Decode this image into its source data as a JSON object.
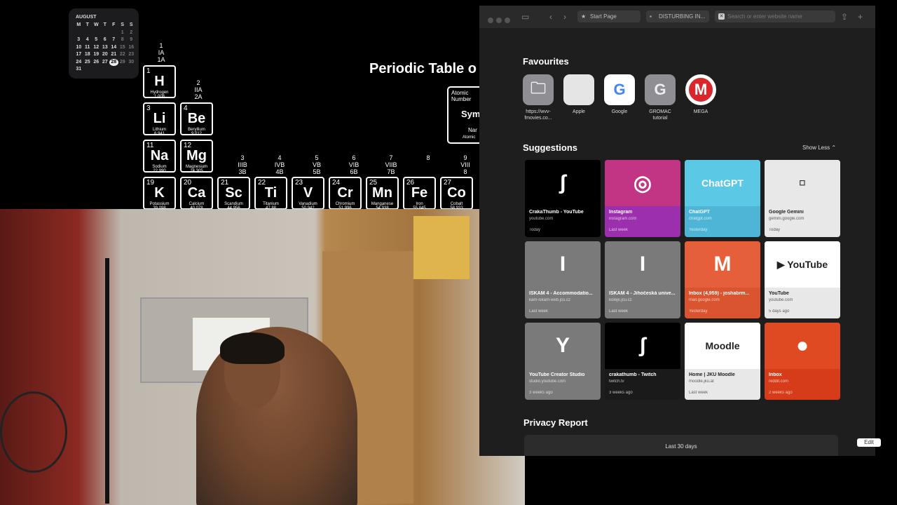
{
  "calendar": {
    "month": "AUGUST",
    "weekdays": [
      "M",
      "T",
      "W",
      "T",
      "F",
      "S",
      "S"
    ],
    "rows": [
      [
        "",
        "",
        "",
        "",
        "",
        "1",
        "2"
      ],
      [
        "3",
        "4",
        "5",
        "6",
        "7",
        "8",
        "9"
      ],
      [
        "10",
        "11",
        "12",
        "13",
        "14",
        "15",
        "16"
      ],
      [
        "17",
        "18",
        "19",
        "20",
        "21",
        "22",
        "23"
      ],
      [
        "24",
        "25",
        "26",
        "27",
        "28",
        "29",
        "30"
      ],
      [
        "31",
        "",
        "",
        "",
        "",
        "",
        ""
      ]
    ],
    "today": "28"
  },
  "periodic": {
    "title": "Periodic Table o",
    "group1": [
      "1",
      "IA",
      "1A"
    ],
    "group2": [
      "2",
      "IIA",
      "2A"
    ],
    "groups": [
      [
        "3",
        "IIIB",
        "3B"
      ],
      [
        "4",
        "IVB",
        "4B"
      ],
      [
        "5",
        "VB",
        "5B"
      ],
      [
        "6",
        "VIB",
        "6B"
      ],
      [
        "7",
        "VIIB",
        "7B"
      ],
      [
        "8",
        ""
      ],
      [
        "9",
        "VIII",
        "8"
      ]
    ],
    "legend": {
      "top": "Atomic Number",
      "mid": "Sym",
      "low": "Nar",
      "bottom": "Atomic"
    },
    "elements": [
      {
        "n": "1",
        "s": "H",
        "name": "Hydrogen",
        "m": "1.008"
      },
      {
        "n": "3",
        "s": "Li",
        "name": "Lithium",
        "m": "6.941"
      },
      {
        "n": "4",
        "s": "Be",
        "name": "Beryllium",
        "m": "9.012"
      },
      {
        "n": "11",
        "s": "Na",
        "name": "Sodium",
        "m": "22.990"
      },
      {
        "n": "12",
        "s": "Mg",
        "name": "Magnesium",
        "m": "24.305"
      },
      {
        "n": "19",
        "s": "K",
        "name": "Potassium",
        "m": "39.098"
      },
      {
        "n": "20",
        "s": "Ca",
        "name": "Calcium",
        "m": "40.078"
      },
      {
        "n": "21",
        "s": "Sc",
        "name": "Scandium",
        "m": "44.956"
      },
      {
        "n": "22",
        "s": "Ti",
        "name": "Titanium",
        "m": "47.88"
      },
      {
        "n": "23",
        "s": "V",
        "name": "Vanadium",
        "m": "50.942"
      },
      {
        "n": "24",
        "s": "Cr",
        "name": "Chromium",
        "m": "51.996"
      },
      {
        "n": "25",
        "s": "Mn",
        "name": "Manganese",
        "m": "54.938"
      },
      {
        "n": "26",
        "s": "Fe",
        "name": "Iron",
        "m": "55.845"
      },
      {
        "n": "27",
        "s": "Co",
        "name": "Cobalt",
        "m": "58.933"
      }
    ]
  },
  "safari": {
    "tabs": {
      "start": "Start Page",
      "second": "DISTURBING IN..."
    },
    "address_placeholder": "Search or enter website name",
    "favourites_title": "Favourites",
    "favourites": [
      {
        "label": "https://wvv-fmovies.co...",
        "icon": "folder-icon",
        "glyph": "🗀",
        "bg": "#8e8e93"
      },
      {
        "label": "Apple",
        "icon": "apple-icon",
        "glyph": "",
        "bg": "#e5e5e5"
      },
      {
        "label": "Google",
        "icon": "google-icon",
        "glyph": "G",
        "bg": "#ffffff"
      },
      {
        "label": "GROMAC tutorial",
        "icon": "letter-g-icon",
        "glyph": "G",
        "bg": "#8e8e93"
      },
      {
        "label": "MEGA",
        "icon": "mega-icon",
        "glyph": "M",
        "bg": "#ffffff"
      }
    ],
    "suggestions_title": "Suggestions",
    "show_less": "Show Less ⌃",
    "suggestions": [
      {
        "title": "CrakaThumb - YouTube",
        "url": "youtube.com",
        "when": "Today",
        "bg": "#000000",
        "thumb": "#000",
        "glyph": "ʃ",
        "fg": "#fff"
      },
      {
        "title": "Instagram",
        "url": "instagram.com",
        "when": "Last week",
        "bg": "#9b2fae",
        "thumb": "#c13584",
        "glyph": "◎",
        "fg": "#fff"
      },
      {
        "title": "ChatGPT",
        "url": "chatgpt.com",
        "when": "Yesterday",
        "bg": "#4fb5d6",
        "thumb": "#5bc8e6",
        "glyph": "ChatGPT",
        "fg": "#fff"
      },
      {
        "title": "Google Gemini",
        "url": "gemini.google.com",
        "when": "Today",
        "bg": "#e8e8e8",
        "thumb": "#e8e8e8",
        "glyph": "▫",
        "fg": "#333"
      },
      {
        "title": "ISKAM 4 - Accommodatio...",
        "url": "kam-iskam-web.jcu.cz",
        "when": "Last week",
        "bg": "#7a7a7a",
        "thumb": "#7a7a7a",
        "glyph": "I",
        "fg": "#fff"
      },
      {
        "title": "ISKAM 4 - Jihočeská unive...",
        "url": "koleje.jcu.cz",
        "when": "Last week",
        "bg": "#7a7a7a",
        "thumb": "#7a7a7a",
        "glyph": "I",
        "fg": "#fff"
      },
      {
        "title": "Inbox (4,959) - joshabrm...",
        "url": "mail.google.com",
        "when": "Yesterday",
        "bg": "#d9542f",
        "thumb": "#e5603a",
        "glyph": "M",
        "fg": "#fff"
      },
      {
        "title": "YouTube",
        "url": "youtube.com",
        "when": "5 days ago",
        "bg": "#e8e8e8",
        "thumb": "#ffffff",
        "glyph": "▶ YouTube",
        "fg": "#222"
      },
      {
        "title": "YouTube Creator Studio",
        "url": "studio.youtube.com",
        "when": "3 weeks ago",
        "bg": "#7a7a7a",
        "thumb": "#7a7a7a",
        "glyph": "Y",
        "fg": "#fff"
      },
      {
        "title": "crakathumb - Twitch",
        "url": "twitch.tv",
        "when": "3 weeks ago",
        "bg": "#1a1a1a",
        "thumb": "#000",
        "glyph": "ʃ",
        "fg": "#fff"
      },
      {
        "title": "Home | JKU Moodle",
        "url": "moodle.jku.at",
        "when": "Last week",
        "bg": "#e8e8e8",
        "thumb": "#ffffff",
        "glyph": "Moodle",
        "fg": "#222"
      },
      {
        "title": "Inbox",
        "url": "reddit.com",
        "when": "2 weeks ago",
        "bg": "#d63c1a",
        "thumb": "#e04a22",
        "glyph": "●",
        "fg": "#fff"
      }
    ],
    "privacy_title": "Privacy Report",
    "privacy_period": "Last 30 days",
    "edit": "Edit"
  }
}
